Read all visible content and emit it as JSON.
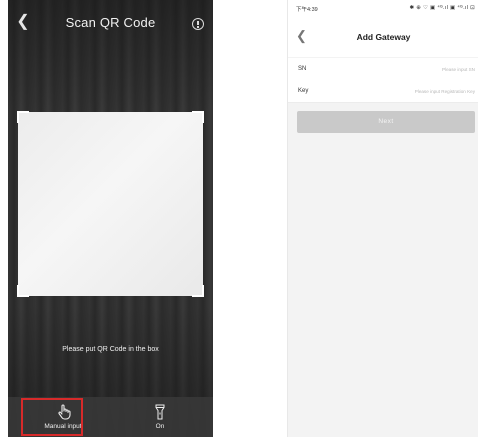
{
  "scanner": {
    "title": "Scan QR Code",
    "hint": "Please put QR Code in the box",
    "manual_input_label": "Manual input",
    "torch_label": "On",
    "highlight_color": "#d72a2a",
    "icons": [
      "back-icon",
      "info-icon",
      "hand-icon",
      "flashlight-icon"
    ]
  },
  "gateway": {
    "status_time": "下午4:39",
    "status_icons": "✱ ⊕ ♡ ▣ ⁴ᴳ.ıl ▣ ⁴ᴳ.ıl ⊡",
    "title": "Add Gateway",
    "fields": [
      {
        "label": "SN",
        "placeholder": "Please input SN",
        "value": ""
      },
      {
        "label": "Key",
        "placeholder": "Please input Registration Key",
        "value": ""
      }
    ],
    "next_label": "Next",
    "next_color": "#c9c9c9"
  }
}
